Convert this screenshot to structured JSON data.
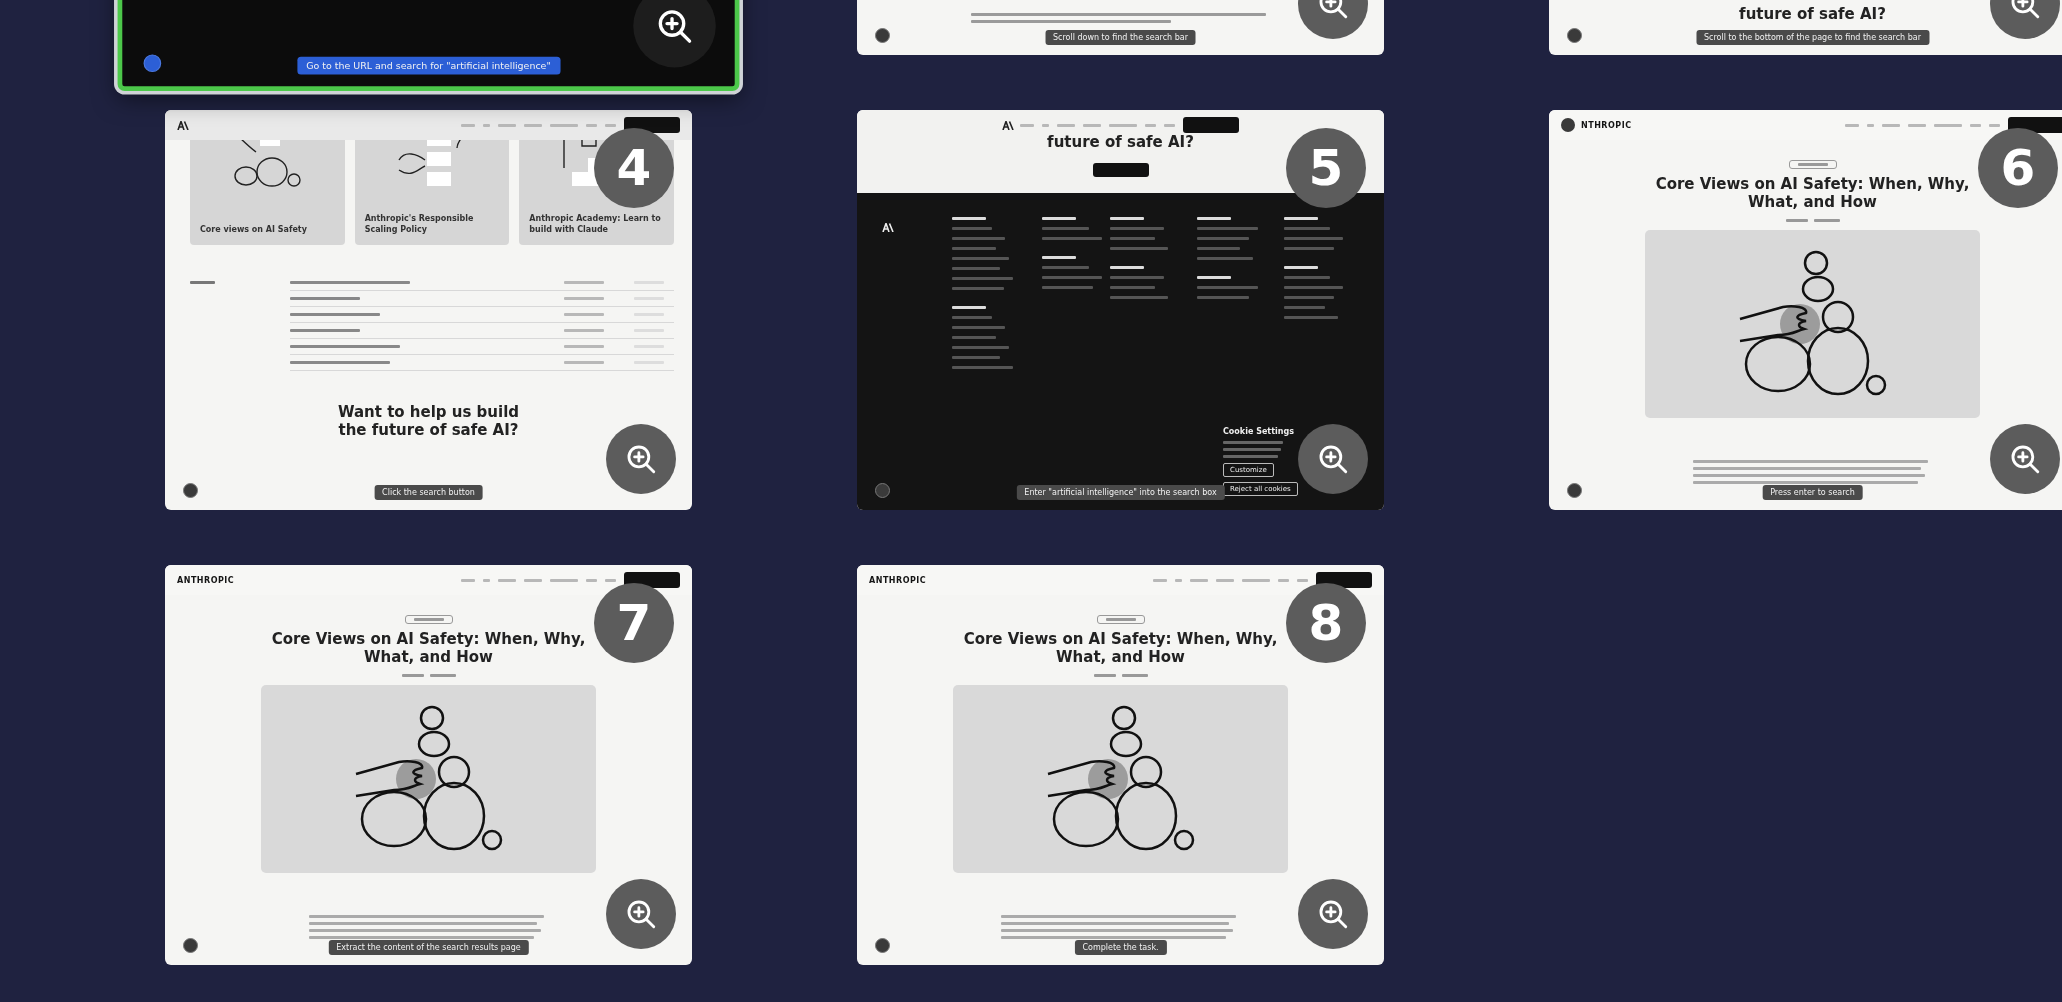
{
  "steps": [
    {
      "kind": "screen",
      "selected": true,
      "caption": "Go to the URL and search for \"artificial intelligence\""
    },
    {
      "kind": "text",
      "selected": false,
      "caption": "Scroll down to find the search bar"
    },
    {
      "kind": "cta",
      "selected": false,
      "heading": "future of safe AI?",
      "caption": "Scroll to the bottom of the page to find the search bar"
    },
    {
      "kind": "listing",
      "selected": false,
      "number": "4",
      "cards": [
        "Core views on AI Safety",
        "Anthropic's Responsible Scaling Policy",
        "Anthropic Academy: Learn to build with Claude"
      ],
      "heading": "Want to help us build the future of safe AI?",
      "caption": "Click the search button"
    },
    {
      "kind": "footer",
      "selected": false,
      "number": "5",
      "heading": "future of safe AI?",
      "cookie": {
        "title": "Cookie Settings",
        "buttons": [
          "Customize",
          "Reject all cookies"
        ]
      },
      "caption": "Enter \"artificial intelligence\" into the search box"
    },
    {
      "kind": "article",
      "selected": false,
      "number": "6",
      "nav": {
        "logo": "NTHROPIC",
        "cursor_over_logo": true
      },
      "title": "Core Views on AI Safety: When, Why, What, and How",
      "caption": "Press enter to search"
    },
    {
      "kind": "article",
      "selected": false,
      "number": "7",
      "nav": {
        "logo": "ANTHROPIC"
      },
      "title": "Core Views on AI Safety: When, Why, What, and How",
      "caption": "Extract the content of the search results page"
    },
    {
      "kind": "article",
      "selected": false,
      "number": "8",
      "nav": {
        "logo": "ANTHROPIC"
      },
      "title": "Core Views on AI Safety: When, Why, What, and How",
      "caption": "Complete the task."
    }
  ]
}
